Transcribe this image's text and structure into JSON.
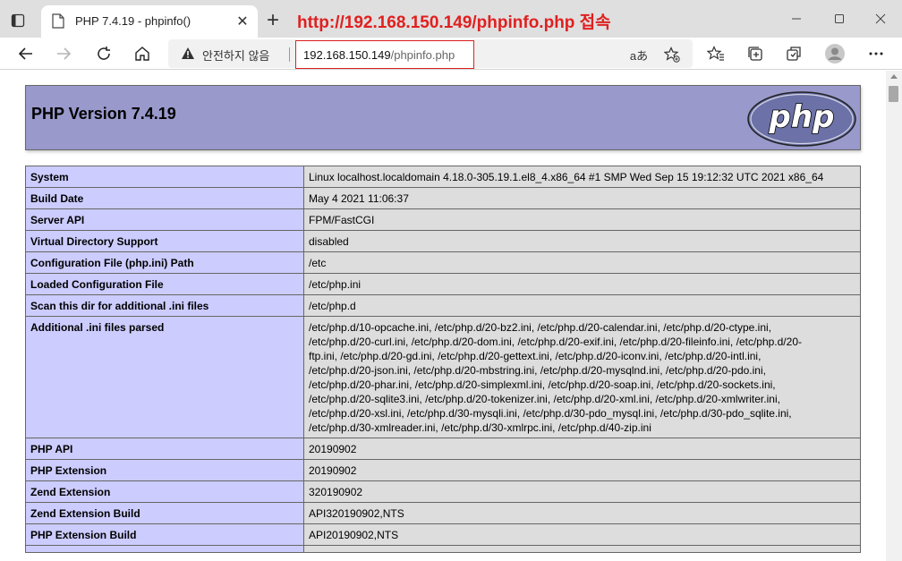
{
  "browser": {
    "tab_title": "PHP 7.4.19 - phpinfo()",
    "annotation": "http://192.168.150.149/phpinfo.php 접속",
    "security_label": "안전하지 않음",
    "url_host": "192.168.150.149",
    "url_path": "/phpinfo.php",
    "read_aloud_glyph": "aあ"
  },
  "page": {
    "title": "PHP Version 7.4.19",
    "logo_text": "php",
    "rows": [
      {
        "key": "System",
        "lines": [
          "Linux localhost.localdomain 4.18.0-305.19.1.el8_4.x86_64 #1 SMP Wed Sep 15 19:12:32 UTC 2021 x86_64"
        ]
      },
      {
        "key": "Build Date",
        "lines": [
          "May 4 2021 11:06:37"
        ]
      },
      {
        "key": "Server API",
        "lines": [
          "FPM/FastCGI"
        ]
      },
      {
        "key": "Virtual Directory Support",
        "lines": [
          "disabled"
        ]
      },
      {
        "key": "Configuration File (php.ini) Path",
        "lines": [
          "/etc"
        ]
      },
      {
        "key": "Loaded Configuration File",
        "lines": [
          "/etc/php.ini"
        ]
      },
      {
        "key": "Scan this dir for additional .ini files",
        "lines": [
          "/etc/php.d"
        ]
      },
      {
        "key": "Additional .ini files parsed",
        "lines": [
          "/etc/php.d/10-opcache.ini, /etc/php.d/20-bz2.ini, /etc/php.d/20-calendar.ini, /etc/php.d/20-ctype.ini,",
          "/etc/php.d/20-curl.ini, /etc/php.d/20-dom.ini, /etc/php.d/20-exif.ini, /etc/php.d/20-fileinfo.ini, /etc/php.d/20-",
          "ftp.ini, /etc/php.d/20-gd.ini, /etc/php.d/20-gettext.ini, /etc/php.d/20-iconv.ini, /etc/php.d/20-intl.ini,",
          "/etc/php.d/20-json.ini, /etc/php.d/20-mbstring.ini, /etc/php.d/20-mysqlnd.ini, /etc/php.d/20-pdo.ini,",
          "/etc/php.d/20-phar.ini, /etc/php.d/20-simplexml.ini, /etc/php.d/20-soap.ini, /etc/php.d/20-sockets.ini,",
          "/etc/php.d/20-sqlite3.ini, /etc/php.d/20-tokenizer.ini, /etc/php.d/20-xml.ini, /etc/php.d/20-xmlwriter.ini,",
          "/etc/php.d/20-xsl.ini, /etc/php.d/30-mysqli.ini, /etc/php.d/30-pdo_mysql.ini, /etc/php.d/30-pdo_sqlite.ini,",
          "/etc/php.d/30-xmlreader.ini, /etc/php.d/30-xmlrpc.ini, /etc/php.d/40-zip.ini"
        ]
      },
      {
        "key": "PHP API",
        "lines": [
          "20190902"
        ]
      },
      {
        "key": "PHP Extension",
        "lines": [
          "20190902"
        ]
      },
      {
        "key": "Zend Extension",
        "lines": [
          "320190902"
        ]
      },
      {
        "key": "Zend Extension Build",
        "lines": [
          "API320190902,NTS"
        ]
      },
      {
        "key": "PHP Extension Build",
        "lines": [
          "API20190902,NTS"
        ]
      },
      {
        "key": "",
        "lines": [
          ""
        ]
      }
    ]
  },
  "colors": {
    "header_bg": "#9999cc",
    "key_cell_bg": "#ccccff",
    "value_cell_bg": "#dddddd",
    "annotation_red": "#e02020"
  },
  "icons": [
    "tab-actions-icon",
    "page-icon",
    "close-icon",
    "plus-icon",
    "minimize-icon",
    "maximize-icon",
    "window-close-icon",
    "back-arrow-icon",
    "forward-arrow-icon",
    "refresh-icon",
    "home-icon",
    "warning-icon",
    "read-aloud-icon",
    "add-favorite-icon",
    "favorites-icon",
    "collections-icon",
    "extensions-icon",
    "profile-icon",
    "more-icon"
  ]
}
